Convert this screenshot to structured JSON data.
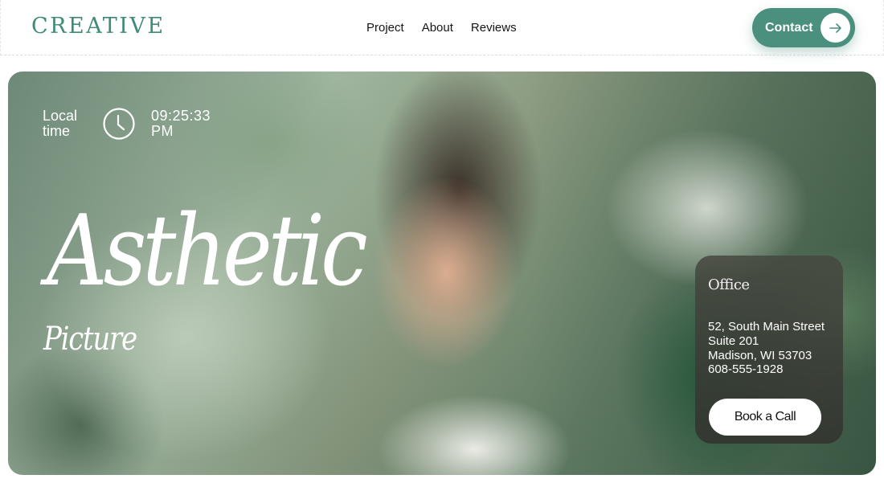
{
  "header": {
    "logo": "CREATIVE",
    "nav": [
      {
        "label": "Project"
      },
      {
        "label": "About"
      },
      {
        "label": "Reviews"
      }
    ],
    "contact_label": "Contact",
    "contact_icon": "arrow-right-icon"
  },
  "hero": {
    "local_time_label": "Local time",
    "clock_icon": "clock-icon",
    "time": "09:25:33 PM",
    "headline": "Asthetic",
    "subhead": "Picture"
  },
  "office": {
    "title": "Office",
    "address_line1": "52, South Main Street",
    "address_line2": "Suite 201",
    "address_line3": "Madison, WI 53703",
    "phone": "608-555-1928",
    "book_label": "Book a Call"
  },
  "colors": {
    "brand": "#3f8a78",
    "button": "#4b8f7e"
  }
}
